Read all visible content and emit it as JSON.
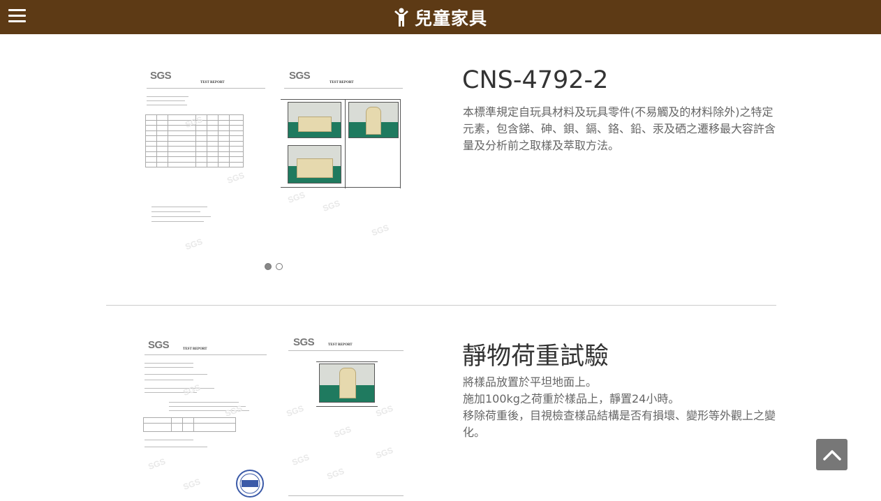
{
  "header": {
    "title": "兒童家具",
    "menu_icon": "hamburger-menu-icon",
    "logo_icon": "child-figure-icon",
    "bg_color": "#5d3a15"
  },
  "sections": [
    {
      "title": "CNS-4792-2",
      "description": "本標準規定自玩具材料及玩具零件(不易觸及的材料除外)之特定元素，包含銻、砷、鋇、鎘、鉻、鉛、汞及硒之遷移最大容許含量及分析前之取樣及萃取方法。",
      "doc_logo": "SGS",
      "doc_title": "TEST REPORT",
      "carousel": {
        "pages": 2,
        "active": 1
      }
    },
    {
      "title": "靜物荷重試驗",
      "description_lines": [
        "將樣品放置於平坦地面上。",
        "施加100kg之荷重於樣品上，靜置24小時。",
        "移除荷重後，目視檢查樣品結構是否有損壞、變形等外觀上之變化。"
      ],
      "doc_logo": "SGS",
      "doc_title": "TEST REPORT"
    }
  ],
  "back_to_top_icon": "chevron-up-icon"
}
